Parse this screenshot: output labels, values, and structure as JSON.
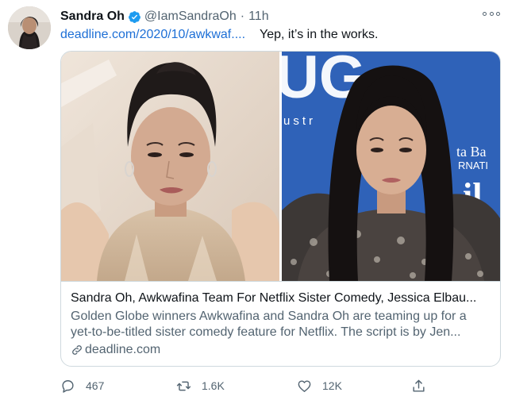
{
  "author": {
    "name": "Sandra Oh",
    "handle": "@IamSandraOh",
    "separator": "·",
    "time": "11h",
    "avatar_icon": "avatar-photo",
    "verified_icon": "verified-badge-icon"
  },
  "tweet": {
    "link_text": "deadline.com/2020/10/awkwaf....",
    "text": "Yep, it’s in the works."
  },
  "card": {
    "title": "Sandra Oh, Awkwafina Team For Netflix Sister Comedy, Jessica Elbau...",
    "description_line1": "Golden Globe winners Awkwafina and Sandra Oh are teaming up for a",
    "description_line2": "yet-to-be-titled sister comedy feature for Netflix. The script is by Jen...",
    "domain": "deadline.com",
    "backdrop_letters": "UG",
    "backdrop_small": "ustr",
    "backdrop_side1": "ta Ba",
    "backdrop_side2": "RNATI",
    "backdrop_side3": "il"
  },
  "actions": {
    "reply_count": "467",
    "retweet_count": "1.6K",
    "like_count": "12K"
  },
  "colors": {
    "link": "#1d6fd6",
    "verified": "#1d9bf0",
    "secondary_text": "#536471",
    "border": "#cfd9de",
    "backdrop_blue": "#2f62b8"
  },
  "icons": [
    "more-options-icon",
    "verified-badge-icon",
    "link-icon",
    "reply-icon",
    "retweet-icon",
    "like-icon",
    "share-icon"
  ]
}
